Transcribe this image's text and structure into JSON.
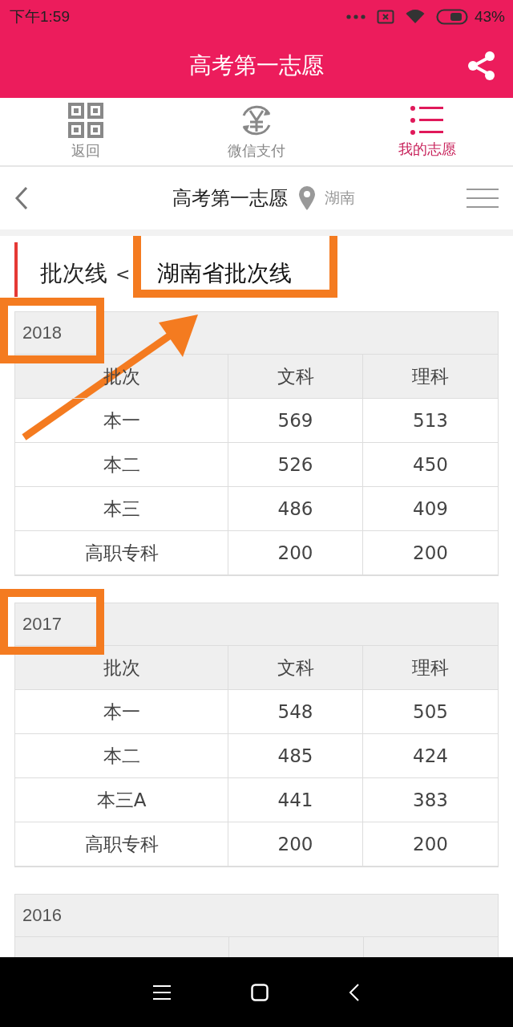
{
  "status_bar": {
    "time": "下午1:59",
    "battery": "43%"
  },
  "header": {
    "title": "高考第一志愿"
  },
  "tabs": [
    {
      "kind": "qr",
      "label": "返回",
      "selected": false
    },
    {
      "kind": "pay",
      "label": "微信支付",
      "selected": false
    },
    {
      "kind": "list",
      "label": "我的志愿",
      "selected": true
    }
  ],
  "nav": {
    "title": "高考第一志愿",
    "location": "湖南"
  },
  "breadcrumb": {
    "parent": "批次线",
    "separator": "<",
    "current": "湖南省批次线",
    "current_highlighted": true
  },
  "years": [
    {
      "year": "2018",
      "highlighted": true,
      "columns": [
        "批次",
        "文科",
        "理科"
      ],
      "rows": [
        [
          "本一",
          "569",
          "513"
        ],
        [
          "本二",
          "526",
          "450"
        ],
        [
          "本三",
          "486",
          "409"
        ],
        [
          "高职专科",
          "200",
          "200"
        ]
      ]
    },
    {
      "year": "2017",
      "highlighted": true,
      "columns": [
        "批次",
        "文科",
        "理科"
      ],
      "rows": [
        [
          "本一",
          "548",
          "505"
        ],
        [
          "本二",
          "485",
          "424"
        ],
        [
          "本三A",
          "441",
          "383"
        ],
        [
          "高职专科",
          "200",
          "200"
        ]
      ]
    },
    {
      "year": "2016",
      "highlighted": false
    }
  ]
}
